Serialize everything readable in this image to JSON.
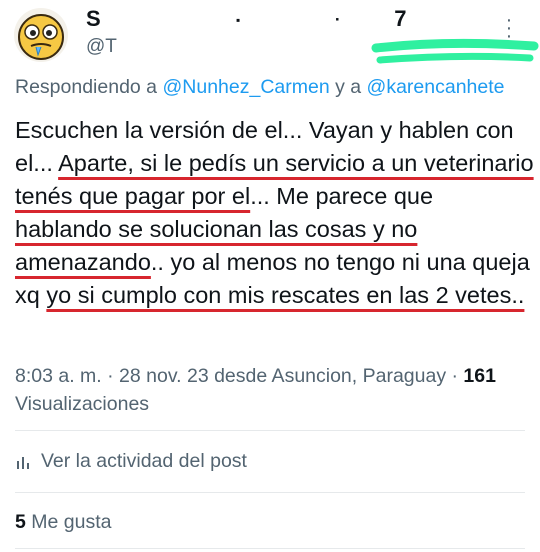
{
  "author": {
    "name_visible": "S",
    "name_fragment": "7",
    "handle": "@T"
  },
  "reply": {
    "prefix": "Respondiendo a",
    "mention1": "@Nunhez_Carmen",
    "connector": "y a",
    "mention2": "@karencanhete"
  },
  "tweet": {
    "part1": "Escuchen la versión de el... Vayan y hablen con el... ",
    "part2": "Aparte, si le pedís un servicio a un veterinario tenés que pagar por el",
    "part3": "... Me parece que ",
    "part4": "hablando se solucionan las cosas y no amenazando",
    "part5": ".. yo al menos no tengo ni una queja xq ",
    "part6": "yo si cumplo con mis rescates en las 2 vetes..",
    "part7": ""
  },
  "meta": {
    "time": "8:03 a. m. · 28 nov. 23 desde Asuncion, Paraguay ·",
    "views_count": "161",
    "views_label": "Visualizaciones"
  },
  "activity": {
    "label": "Ver la actividad del post"
  },
  "likes": {
    "count": "5",
    "label": "Me gusta"
  },
  "colors": {
    "mention": "#1d9bf0",
    "underline": "#d7262e",
    "highlighter": "#2ff0a0",
    "secondary_text": "#536471"
  },
  "icons": {
    "avatar": "emoji-face-avatar",
    "more": "more-options-icon",
    "activity": "bar-chart-icon"
  }
}
